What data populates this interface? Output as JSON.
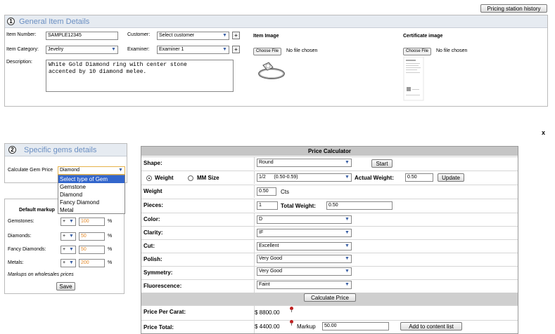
{
  "top": {
    "history_button": "Pricing station history"
  },
  "general": {
    "num": "1",
    "title": "General Item Details",
    "item_number_label": "Item Number:",
    "item_number_value": "SAMPLE12345",
    "item_category_label": "Item Category:",
    "item_category_value": "Jevelry",
    "description_label": "Description:",
    "description_value": "White Gold Diamond ring with center stone\naccented by 10 diamond melee.",
    "customer_label": "Customer:",
    "customer_value": "Select customer",
    "examiner_label": "Examiner:",
    "examiner_value": "Examiner 1",
    "plus": "+",
    "item_image_label": "Item Image",
    "certificate_image_label": "Certificate image",
    "choose_file": "Choose File",
    "no_file": "No file chosen"
  },
  "close_x": "x",
  "gems": {
    "num": "2",
    "title": "Specific gems details",
    "calc_price_label": "Calculate Gem Price",
    "calc_price_value": "Diamond",
    "dropdown_options": [
      "Select type of Gem",
      "Gemstone",
      "Diamond",
      "Fancy Diamond",
      "Metal"
    ],
    "default_markup_label": "Default markup",
    "rows": [
      {
        "label": "Gemstones:",
        "sign": "+",
        "value": "100",
        "unit": "%"
      },
      {
        "label": "Diamonds:",
        "sign": "+",
        "value": "50",
        "unit": "%"
      },
      {
        "label": "Fancy Diamonds:",
        "sign": "+",
        "value": "50",
        "unit": "%"
      },
      {
        "label": "Metals:",
        "sign": "+",
        "value": "200",
        "unit": "%"
      }
    ],
    "note": "Markups on wholesales prices",
    "save": "Save"
  },
  "calc": {
    "title": "Price Calculator",
    "shape_label": "Shape:",
    "shape_value": "Round",
    "start": "Start",
    "weight_radio": "Weight",
    "mm_radio": "MM Size",
    "size_value": "1/2      (0.50-0.59)",
    "actual_weight_label": "Actual Weight:",
    "actual_weight_value": "0.50",
    "update": "Update",
    "weight_label": "Weight",
    "weight_value": "0.50",
    "weight_unit": "Cts",
    "pieces_label": "Pieces:",
    "pieces_value": "1",
    "total_weight_label": "Total Weight:",
    "total_weight_value": "0.50",
    "color_label": "Color:",
    "color_value": "D",
    "clarity_label": "Clarity:",
    "clarity_value": "IF",
    "cut_label": "Cut:",
    "cut_value": "Excellent",
    "polish_label": "Polish:",
    "polish_value": "Very Good",
    "symmetry_label": "Symmetry:",
    "symmetry_value": "Very Good",
    "fluor_label": "Fluorescence:",
    "fluor_value": "Faint",
    "calculate": "Calculate Price",
    "ppc_label": "Price Per Carat:",
    "ppc_value": "$ 8800.00",
    "total_label": "Price Total:",
    "total_value": "$ 4400.00",
    "markup_label": "Markup",
    "markup_value": "50.00",
    "add": "Add to content list"
  }
}
